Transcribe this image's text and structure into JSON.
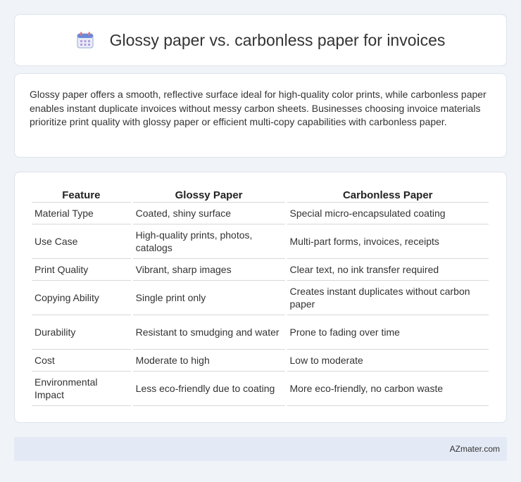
{
  "header": {
    "title": "Glossy paper vs. carbonless paper for invoices",
    "icon": "calendar-icon"
  },
  "intro": {
    "text": "Glossy paper offers a smooth, reflective surface ideal for high-quality color prints, while carbonless paper enables instant duplicate invoices without messy carbon sheets. Businesses choosing invoice materials prioritize print quality with glossy paper or efficient multi-copy capabilities with carbonless paper."
  },
  "table": {
    "headers": [
      "Feature",
      "Glossy Paper",
      "Carbonless Paper"
    ],
    "rows": [
      [
        "Material Type",
        "Coated, shiny surface",
        "Special micro-encapsulated coating"
      ],
      [
        "Use Case",
        "High-quality prints, photos, catalogs",
        "Multi-part forms, invoices, receipts"
      ],
      [
        "Print Quality",
        "Vibrant, sharp images",
        "Clear text, no ink transfer required"
      ],
      [
        "Copying Ability",
        "Single print only",
        "Creates instant duplicates without carbon paper"
      ],
      [
        "Durability",
        "Resistant to smudging and water",
        "Prone to fading over time"
      ],
      [
        "Cost",
        "Moderate to high",
        "Low to moderate"
      ],
      [
        "Environmental Impact",
        "Less eco-friendly due to coating",
        "More eco-friendly, no carbon waste"
      ]
    ]
  },
  "footer": {
    "brand": "AZmater.com"
  }
}
